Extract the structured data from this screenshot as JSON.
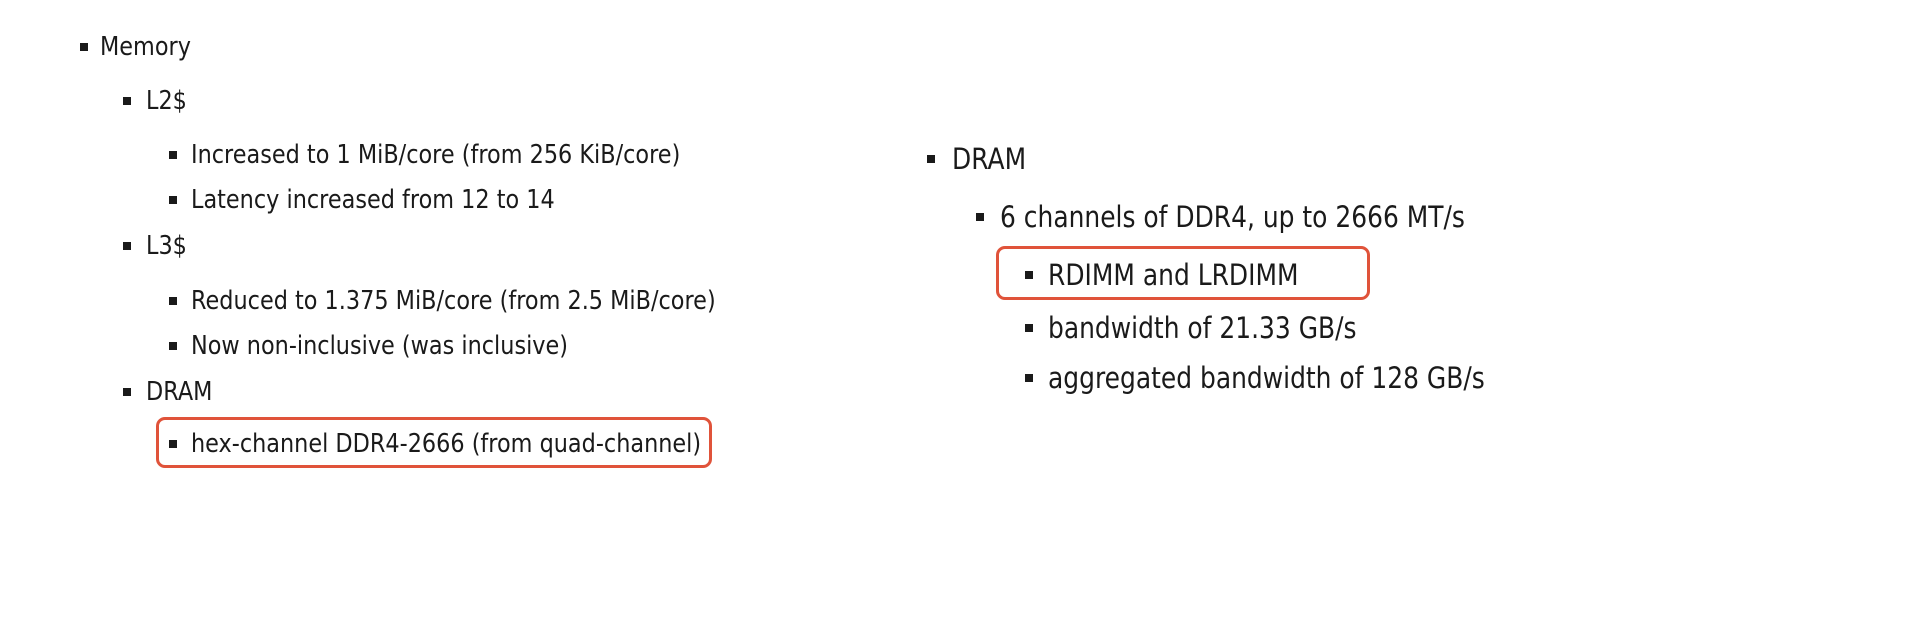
{
  "left": {
    "memory": "Memory",
    "l2": "L2$",
    "l2_items": [
      "Increased to 1 MiB/core (from 256 KiB/core)",
      "Latency increased from 12 to 14"
    ],
    "l3": "L3$",
    "l3_items": [
      "Reduced to 1.375 MiB/core (from 2.5 MiB/core)",
      "Now non-inclusive (was inclusive)"
    ],
    "dram": "DRAM",
    "dram_items": [
      "hex-channel DDR4-2666 (from quad-channel)"
    ]
  },
  "right": {
    "dram": "DRAM",
    "channels": "6 channels of DDR4, up to 2666 MT/s",
    "items": [
      "RDIMM and LRDIMM",
      "bandwidth of 21.33 GB/s",
      "aggregated bandwidth of 128 GB/s"
    ]
  },
  "colors": {
    "highlight": "#e0533a",
    "text": "#1a1a1a"
  }
}
